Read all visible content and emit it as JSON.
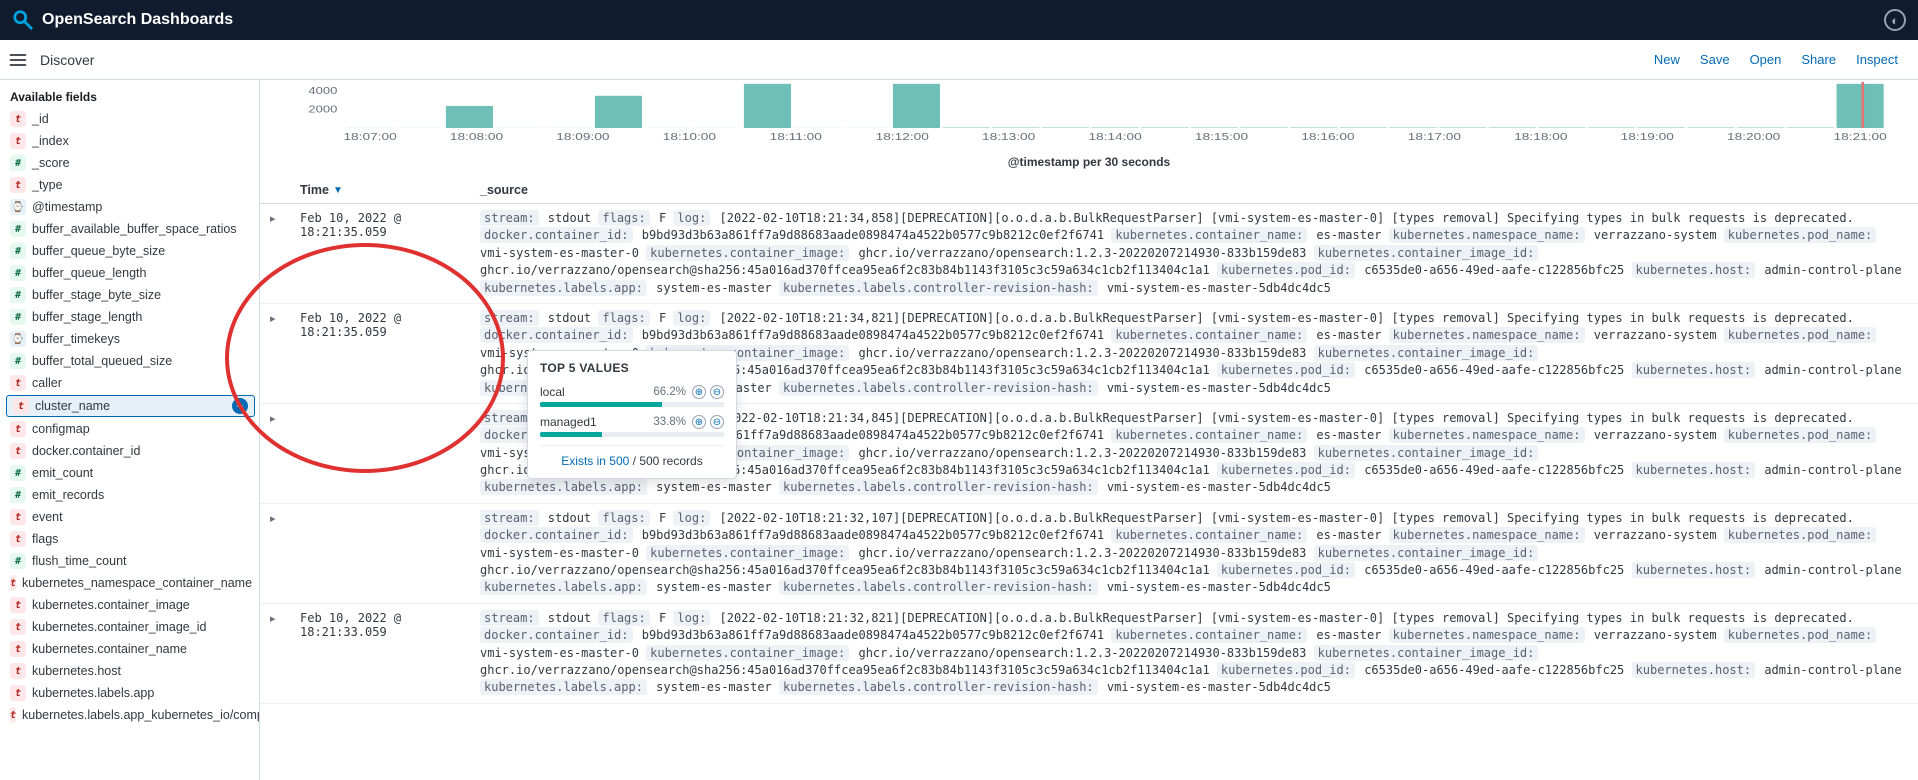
{
  "brand": "OpenSearch Dashboards",
  "page_title": "Discover",
  "top_actions": [
    "New",
    "Save",
    "Open",
    "Share",
    "Inspect"
  ],
  "sidebar": {
    "title": "Available fields",
    "fields": [
      {
        "type": "t",
        "name": "_id"
      },
      {
        "type": "t",
        "name": "_index"
      },
      {
        "type": "n",
        "name": "_score"
      },
      {
        "type": "t",
        "name": "_type"
      },
      {
        "type": "c",
        "name": "@timestamp"
      },
      {
        "type": "n",
        "name": "buffer_available_buffer_space_ratios"
      },
      {
        "type": "n",
        "name": "buffer_queue_byte_size"
      },
      {
        "type": "n",
        "name": "buffer_queue_length"
      },
      {
        "type": "n",
        "name": "buffer_stage_byte_size"
      },
      {
        "type": "n",
        "name": "buffer_stage_length"
      },
      {
        "type": "c",
        "name": "buffer_timekeys"
      },
      {
        "type": "n",
        "name": "buffer_total_queued_size"
      },
      {
        "type": "t",
        "name": "caller"
      },
      {
        "type": "t",
        "name": "cluster_name",
        "selected": true
      },
      {
        "type": "t",
        "name": "configmap"
      },
      {
        "type": "t",
        "name": "docker.container_id"
      },
      {
        "type": "n",
        "name": "emit_count"
      },
      {
        "type": "n",
        "name": "emit_records"
      },
      {
        "type": "t",
        "name": "event"
      },
      {
        "type": "t",
        "name": "flags"
      },
      {
        "type": "n",
        "name": "flush_time_count"
      },
      {
        "type": "t",
        "name": "kubernetes_namespace_container_name"
      },
      {
        "type": "t",
        "name": "kubernetes.container_image"
      },
      {
        "type": "t",
        "name": "kubernetes.container_image_id"
      },
      {
        "type": "t",
        "name": "kubernetes.container_name"
      },
      {
        "type": "t",
        "name": "kubernetes.host"
      },
      {
        "type": "t",
        "name": "kubernetes.labels.app"
      },
      {
        "type": "t",
        "name": "kubernetes.labels.app_kubernetes_io/component"
      }
    ]
  },
  "popover": {
    "title": "TOP 5 VALUES",
    "items": [
      {
        "label": "local",
        "pct": "66.2%",
        "width": 66.2
      },
      {
        "label": "managed1",
        "pct": "33.8%",
        "width": 33.8
      }
    ],
    "footer_link": "Exists in 500",
    "footer_rest": " / 500 records"
  },
  "chart_data": {
    "type": "bar",
    "title": "@timestamp per 30 seconds",
    "y_ticks": [
      2000,
      4000
    ],
    "x_ticks": [
      "18:07:00",
      "18:08:00",
      "18:09:00",
      "18:10:00",
      "18:11:00",
      "18:12:00",
      "18:13:00",
      "18:14:00",
      "18:15:00",
      "18:16:00",
      "18:17:00",
      "18:18:00",
      "18:19:00",
      "18:20:00",
      "18:21:00"
    ],
    "values": [
      10,
      10,
      2400,
      10,
      10,
      3500,
      10,
      10,
      4800,
      10,
      10,
      4800,
      50,
      50,
      50,
      50,
      50,
      50,
      50,
      50,
      50,
      50,
      50,
      50,
      50,
      50,
      50,
      50,
      50,
      50,
      4800
    ]
  },
  "table": {
    "columns": {
      "time": "Time",
      "source": "_source"
    },
    "rows": [
      {
        "time": "Feb 10, 2022 @ 18:21:35.059",
        "log": "[2022-02-10T18:21:34,858][DEPRECATION][o.o.d.a.b.BulkRequestParser] [vmi-system-es-master-0] [types removal] Specifying types in bulk requests is deprecated."
      },
      {
        "time": "Feb 10, 2022 @ 18:21:35.059",
        "log": "[2022-02-10T18:21:34,821][DEPRECATION][o.o.d.a.b.BulkRequestParser] [vmi-system-es-master-0] [types removal] Specifying types in bulk requests is deprecated."
      },
      {
        "time": "",
        "log": "[2022-02-10T18:21:34,845][DEPRECATION][o.o.d.a.b.BulkRequestParser] [vmi-system-es-master-0] [types removal] Specifying types in bulk requests is deprecated."
      },
      {
        "time": "",
        "log": "[2022-02-10T18:21:32,107][DEPRECATION][o.o.d.a.b.BulkRequestParser] [vmi-system-es-master-0] [types removal] Specifying types in bulk requests is deprecated."
      },
      {
        "time": "Feb 10, 2022 @ 18:21:33.059",
        "log": "[2022-02-10T18:21:32,821][DEPRECATION][o.o.d.a.b.BulkRequestParser] [vmi-system-es-master-0] [types removal] Specifying types in bulk requests is deprecated."
      }
    ],
    "common": {
      "stream": "stdout",
      "flags": "F",
      "docker_container_id": "b9bd93d3b63a861ff7a9d88683aade0898474a4522b0577c9b8212c0ef2f6741",
      "k8s_container_name": "es-master",
      "k8s_namespace_name": "verrazzano-system",
      "k8s_pod_name": "vmi-system-es-master-0",
      "k8s_container_image": "ghcr.io/verrazzano/opensearch:1.2.3-20220207214930-833b159de83",
      "k8s_container_image_id": "ghcr.io/verrazzano/opensearch@sha256:45a016ad370ffcea95ea6f2c83b84b1143f3105c3c59a634c1cb2f113404c1a1",
      "k8s_pod_id": "c6535de0-a656-49ed-aafe-c122856bfc25",
      "k8s_host": "admin-control-plane",
      "k8s_labels_app": "system-es-master",
      "k8s_controller_revision_hash": "vmi-system-es-master-5db4dc4dc5"
    }
  }
}
